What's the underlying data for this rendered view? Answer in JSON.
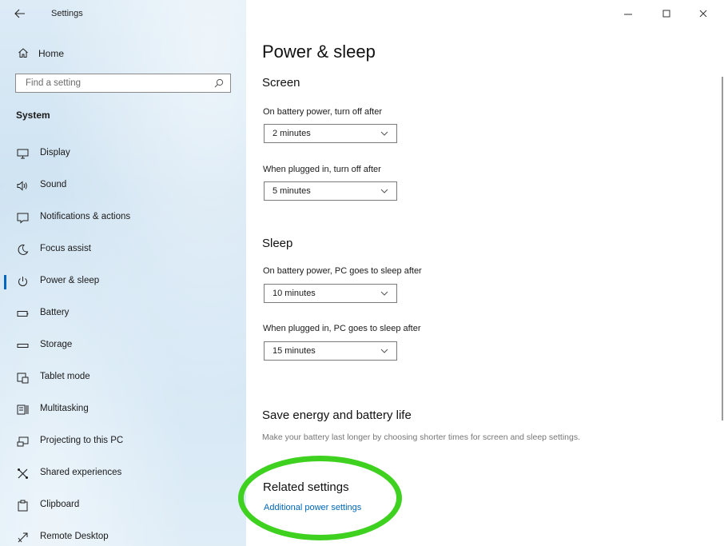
{
  "window": {
    "title": "Settings",
    "controls": {
      "minimize": "—",
      "maximize": "☐",
      "close": "✕"
    }
  },
  "sidebar": {
    "home_label": "Home",
    "search_placeholder": "Find a setting",
    "section_title": "System",
    "items": [
      {
        "label": "Display",
        "icon": "display-icon"
      },
      {
        "label": "Sound",
        "icon": "sound-icon"
      },
      {
        "label": "Notifications & actions",
        "icon": "notifications-icon"
      },
      {
        "label": "Focus assist",
        "icon": "moon-icon"
      },
      {
        "label": "Power & sleep",
        "icon": "power-icon",
        "active": true
      },
      {
        "label": "Battery",
        "icon": "battery-icon"
      },
      {
        "label": "Storage",
        "icon": "storage-icon"
      },
      {
        "label": "Tablet mode",
        "icon": "tablet-mode-icon"
      },
      {
        "label": "Multitasking",
        "icon": "multitasking-icon"
      },
      {
        "label": "Projecting to this PC",
        "icon": "projecting-icon"
      },
      {
        "label": "Shared experiences",
        "icon": "shared-experiences-icon"
      },
      {
        "label": "Clipboard",
        "icon": "clipboard-icon"
      },
      {
        "label": "Remote Desktop",
        "icon": "remote-desktop-icon"
      }
    ]
  },
  "main": {
    "title": "Power & sleep",
    "screen": {
      "heading": "Screen",
      "battery_label": "On battery power, turn off after",
      "battery_value": "2 minutes",
      "plugged_label": "When plugged in, turn off after",
      "plugged_value": "5 minutes"
    },
    "sleep": {
      "heading": "Sleep",
      "battery_label": "On battery power, PC goes to sleep after",
      "battery_value": "10 minutes",
      "plugged_label": "When plugged in, PC goes to sleep after",
      "plugged_value": "15 minutes"
    },
    "save_energy": {
      "heading": "Save energy and battery life",
      "description": "Make your battery last longer by choosing shorter times for screen and sleep settings."
    },
    "related": {
      "heading": "Related settings",
      "link": "Additional power settings"
    }
  },
  "colors": {
    "accent": "#0067c0",
    "link": "#0067b8",
    "highlight_ring": "#3fd11f",
    "sidebar_bg": "#d6e8f5"
  }
}
